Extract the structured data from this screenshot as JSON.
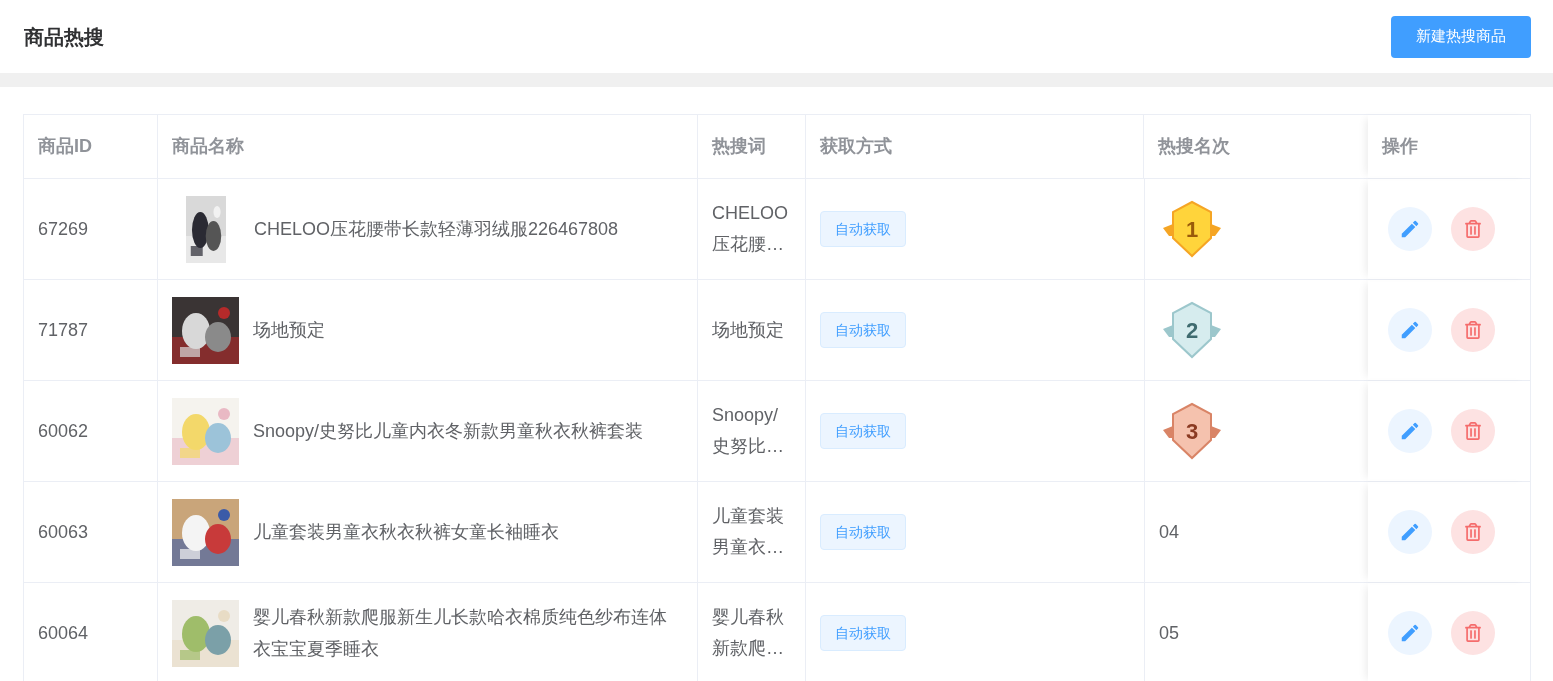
{
  "page": {
    "title": "商品热搜",
    "create_button": "新建热搜商品"
  },
  "table": {
    "columns": [
      "商品ID",
      "商品名称",
      "热搜词",
      "获取方式",
      "热搜名次",
      "操作"
    ],
    "rows": [
      {
        "id": "67269",
        "name": "CHELOO压花腰带长款轻薄羽绒服226467808",
        "thumb": {
          "kind": "portrait"
        },
        "keyword": "CHELOO压花腰…",
        "source": "自动获取",
        "rank": {
          "kind": "gold",
          "text": "1"
        }
      },
      {
        "id": "71787",
        "name": "场地预定",
        "thumb": {
          "kind": "square"
        },
        "keyword": "场地预定",
        "source": "自动获取",
        "rank": {
          "kind": "silver",
          "text": "2"
        }
      },
      {
        "id": "60062",
        "name": "Snoopy/史努比儿童内衣冬新款男童秋衣秋裤套装",
        "thumb": {
          "kind": "square"
        },
        "keyword": "Snoopy/史努比…",
        "source": "自动获取",
        "rank": {
          "kind": "bronze",
          "text": "3"
        }
      },
      {
        "id": "60063",
        "name": "儿童套装男童衣秋衣秋裤女童长袖睡衣",
        "thumb": {
          "kind": "square"
        },
        "keyword": "儿童套装男童衣…",
        "source": "自动获取",
        "rank": {
          "kind": "plain",
          "text": "04"
        }
      },
      {
        "id": "60064",
        "name": "婴儿春秋新款爬服新生儿长款哈衣棉质纯色纱布连体衣宝宝夏季睡衣",
        "thumb": {
          "kind": "square"
        },
        "keyword": "婴儿春秋新款爬…",
        "source": "自动获取",
        "rank": {
          "kind": "plain",
          "text": "05"
        }
      }
    ]
  }
}
